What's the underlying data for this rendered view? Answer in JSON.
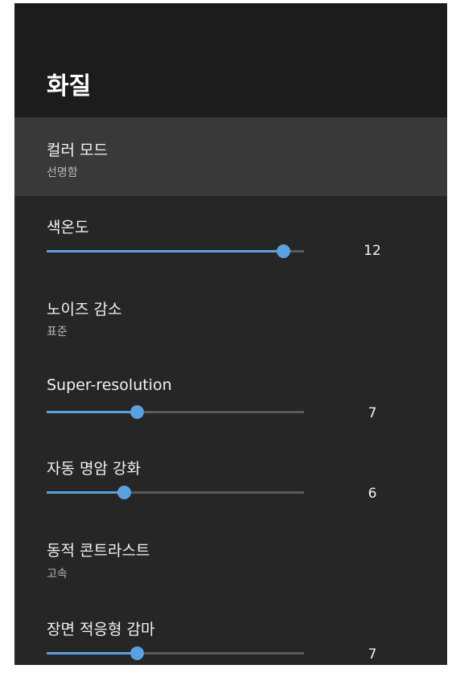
{
  "header": {
    "title": "화질"
  },
  "items": [
    {
      "label": "컬러 모드",
      "sub": "선명함"
    },
    {
      "label": "색온도",
      "value": "12",
      "level": 0.92
    },
    {
      "label": "노이즈 감소",
      "sub": "표준"
    },
    {
      "label": "Super-resolution",
      "value": "7",
      "level": 0.35
    },
    {
      "label": "자동 명암 강화",
      "value": "6",
      "level": 0.3
    },
    {
      "label": "동적 콘트라스트",
      "sub": "고속"
    },
    {
      "label": "장면 적응형 감마",
      "value": "7",
      "level": 0.35
    }
  ],
  "colors": {
    "accent": "#5aa1e0",
    "panel": "#262626",
    "header": "#1c1c1c",
    "focus": "#393939"
  }
}
